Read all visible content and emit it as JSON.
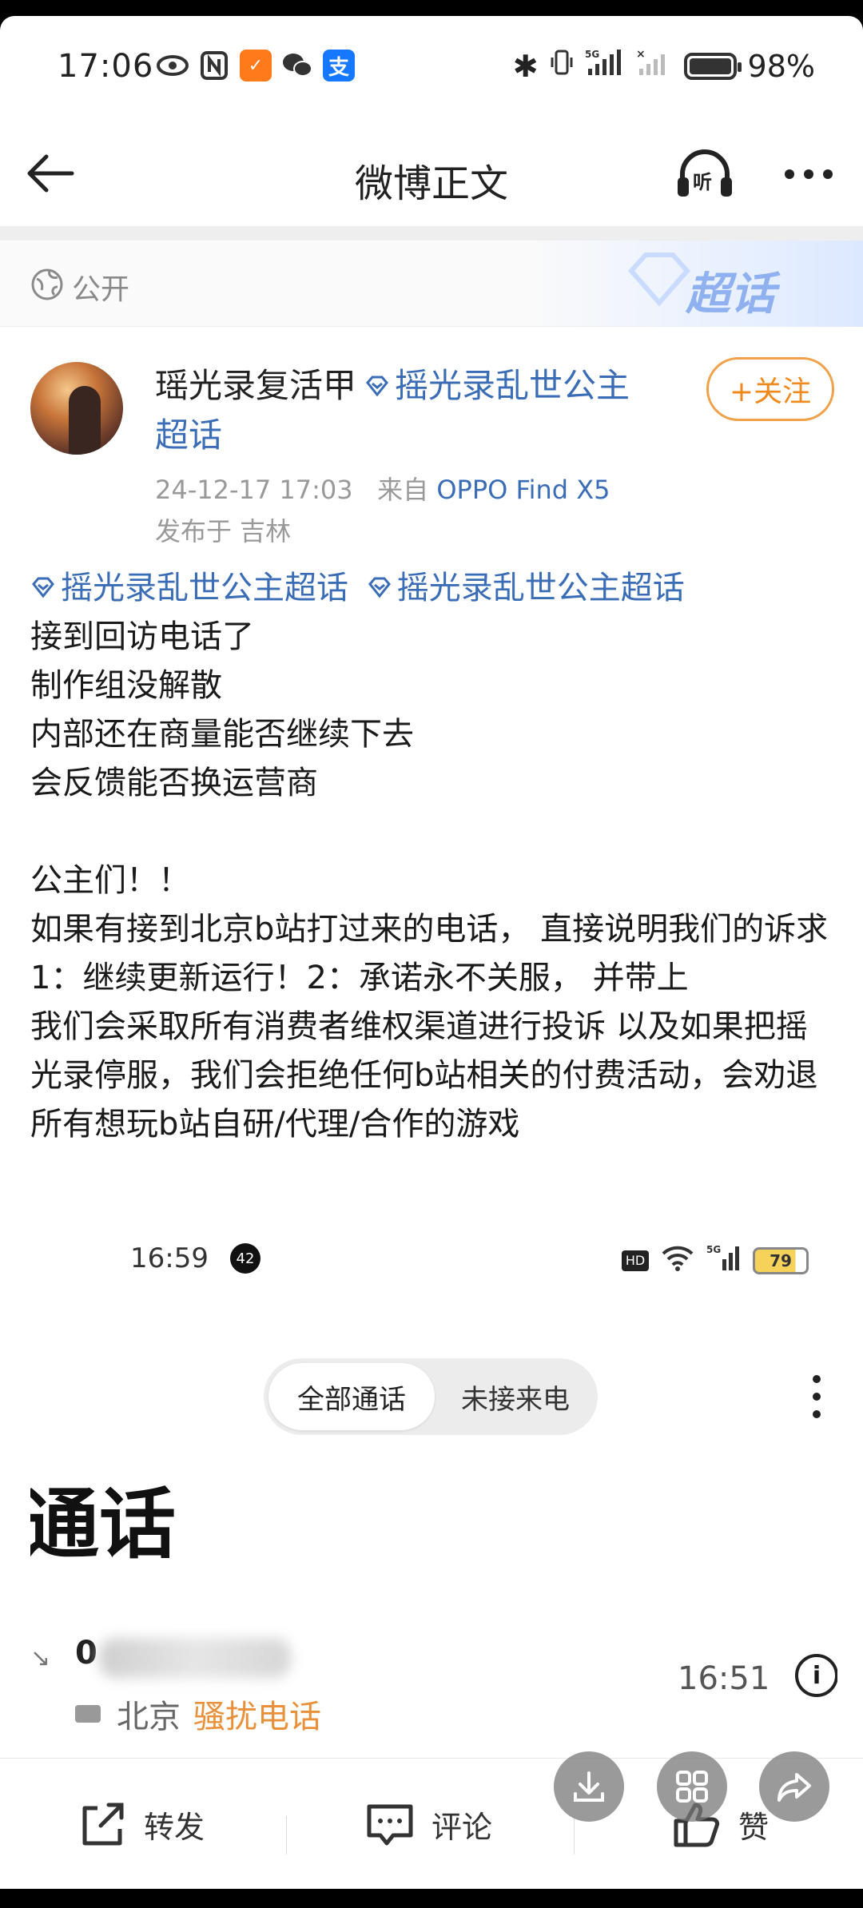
{
  "status_bar": {
    "time": "17:06",
    "battery_percent": "98%",
    "signal_labels": [
      "5G"
    ]
  },
  "header": {
    "title": "微博正文"
  },
  "visibility": {
    "label": "公开",
    "supertopic_badge": "超话"
  },
  "post": {
    "username": "瑶光录复活甲",
    "topic_tag": "摇光录乱世公主超话",
    "follow_label": "+关注",
    "timestamp": "24-12-17 17:03",
    "source_prefix": "来自",
    "device": "OPPO Find X5",
    "location": "发布于 吉林",
    "topics": [
      "摇光录乱世公主超话",
      "摇光录乱世公主超话"
    ],
    "body": "接到回访电话了\n制作组没解散\n内部还在商量能否继续下去\n会反馈能否换运营商\n\n公主们！！\n如果有接到北京b站打过来的电话， 直接说明我们的诉求 1：继续更新运行！2：承诺永不关服， 并带上\n我们会采取所有消费者维权渠道进行投诉 以及如果把摇光录停服，我们会拒绝任何b站相关的付费活动，会劝退所有想玩b站自研/代理/合作的游戏"
  },
  "embedded_screenshot": {
    "time": "16:59",
    "notif_count": "42",
    "battery": "79",
    "tab_all": "全部通话",
    "tab_missed": "未接来电",
    "title": "通话",
    "call_number_prefix": "0",
    "call_time": "16:51",
    "call_location": "北京",
    "call_tag": "骚扰电话"
  },
  "bottom_bar": {
    "repost": "转发",
    "comment": "评论",
    "like": "赞"
  },
  "colors": {
    "link_blue": "#3a6db5",
    "follow_orange": "#f08a1c",
    "spam_orange": "#e8913a"
  }
}
